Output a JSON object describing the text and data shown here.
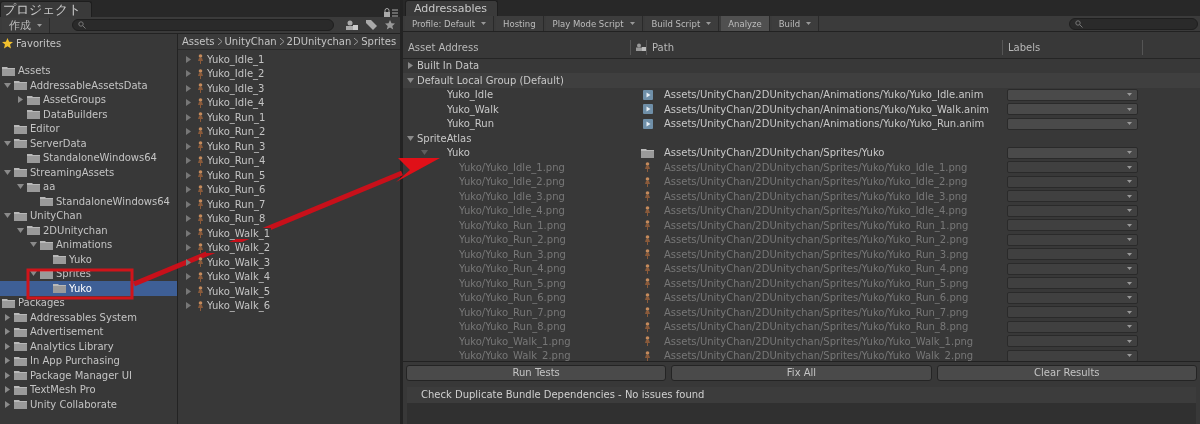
{
  "project": {
    "tab": {
      "label": "プロジェクト",
      "selected": true
    },
    "toolbar": {
      "create": "作成"
    },
    "favorites": {
      "label": "Favorites"
    },
    "tree": [
      {
        "label": "Assets",
        "children": [
          {
            "label": "AddressableAssetsData",
            "expanded": true,
            "children": [
              {
                "label": "AssetGroups",
                "expanded": false
              },
              {
                "label": "DataBuilders"
              }
            ]
          },
          {
            "label": "Editor"
          },
          {
            "label": "ServerData",
            "expanded": true,
            "children": [
              {
                "label": "StandaloneWindows64"
              }
            ]
          },
          {
            "label": "StreamingAssets",
            "expanded": true,
            "children": [
              {
                "label": "aa",
                "expanded": true,
                "children": [
                  {
                    "label": "StandaloneWindows64"
                  }
                ]
              }
            ]
          },
          {
            "label": "UnityChan",
            "expanded": true,
            "children": [
              {
                "label": "2DUnitychan",
                "expanded": true,
                "children": [
                  {
                    "label": "Animations",
                    "expanded": true,
                    "children": [
                      {
                        "label": "Yuko",
                        "selected": false
                      }
                    ]
                  },
                  {
                    "label": "Sprites",
                    "expanded": true,
                    "children": [
                      {
                        "label": "Yuko",
                        "selected": true
                      }
                    ]
                  }
                ]
              }
            ]
          }
        ]
      },
      {
        "label": "Packages",
        "children": [
          {
            "label": "Addressables System",
            "expanded": false
          },
          {
            "label": "Advertisement",
            "expanded": false
          },
          {
            "label": "Analytics Library",
            "expanded": false
          },
          {
            "label": "In App Purchasing",
            "expanded": false
          },
          {
            "label": "Package Manager UI",
            "expanded": false
          },
          {
            "label": "TextMesh Pro",
            "expanded": false
          },
          {
            "label": "Unity Collaborate",
            "expanded": false
          }
        ]
      }
    ],
    "breadcrumb": [
      "Assets",
      "UnityChan",
      "2DUnitychan",
      "Sprites"
    ],
    "files": [
      "Yuko_Idle_1",
      "Yuko_Idle_2",
      "Yuko_Idle_3",
      "Yuko_Idle_4",
      "Yuko_Run_1",
      "Yuko_Run_2",
      "Yuko_Run_3",
      "Yuko_Run_4",
      "Yuko_Run_5",
      "Yuko_Run_6",
      "Yuko_Run_7",
      "Yuko_Run_8",
      "Yuko_Walk_1",
      "Yuko_Walk_2",
      "Yuko_Walk_3",
      "Yuko_Walk_4",
      "Yuko_Walk_5",
      "Yuko_Walk_6"
    ]
  },
  "addressables": {
    "tab": {
      "label": "Addressables",
      "selected": true
    },
    "toolbar": [
      {
        "label": "Profile: Default",
        "kind": "dropdown",
        "selected": false
      },
      {
        "label": "Hosting",
        "kind": "button",
        "selected": false
      },
      {
        "label": "Play Mode Script",
        "kind": "dropdown",
        "selected": false
      },
      {
        "label": "Build Script",
        "kind": "dropdown",
        "selected": false
      },
      {
        "label": "Analyze",
        "kind": "button",
        "selected": true
      },
      {
        "label": "Build",
        "kind": "dropdown",
        "selected": false
      }
    ],
    "columns": [
      "Asset Address",
      "Path",
      "Labels"
    ],
    "groups": [
      {
        "label": "Built In Data",
        "expanded": false
      },
      {
        "label": "Default Local Group (Default)",
        "expanded": true,
        "entries": [
          {
            "address": "Yuko_Idle",
            "kind": "anim",
            "path": "Assets/UnityChan/2DUnitychan/Animations/Yuko/Yuko_Idle.anim",
            "disabled": false
          },
          {
            "address": "Yuko_Walk",
            "kind": "anim",
            "path": "Assets/UnityChan/2DUnitychan/Animations/Yuko/Yuko_Walk.anim",
            "disabled": false
          },
          {
            "address": "Yuko_Run",
            "kind": "anim",
            "path": "Assets/UnityChan/2DUnitychan/Animations/Yuko/Yuko_Run.anim",
            "disabled": false
          }
        ]
      },
      {
        "label": "SpriteAtlas",
        "expanded": true,
        "entries": [
          {
            "address": "Yuko",
            "kind": "folder",
            "path": "Assets/UnityChan/2DUnitychan/Sprites/Yuko",
            "disabled": false,
            "expanded": true,
            "children": [
              {
                "address": "Yuko/Yuko_Idle_1.png",
                "kind": "sprite",
                "path": "Assets/UnityChan/2DUnitychan/Sprites/Yuko/Yuko_Idle_1.png",
                "disabled": true
              },
              {
                "address": "Yuko/Yuko_Idle_2.png",
                "kind": "sprite",
                "path": "Assets/UnityChan/2DUnitychan/Sprites/Yuko/Yuko_Idle_2.png",
                "disabled": true
              },
              {
                "address": "Yuko/Yuko_Idle_3.png",
                "kind": "sprite",
                "path": "Assets/UnityChan/2DUnitychan/Sprites/Yuko/Yuko_Idle_3.png",
                "disabled": true
              },
              {
                "address": "Yuko/Yuko_Idle_4.png",
                "kind": "sprite",
                "path": "Assets/UnityChan/2DUnitychan/Sprites/Yuko/Yuko_Idle_4.png",
                "disabled": true
              },
              {
                "address": "Yuko/Yuko_Run_1.png",
                "kind": "sprite",
                "path": "Assets/UnityChan/2DUnitychan/Sprites/Yuko/Yuko_Run_1.png",
                "disabled": true
              },
              {
                "address": "Yuko/Yuko_Run_2.png",
                "kind": "sprite",
                "path": "Assets/UnityChan/2DUnitychan/Sprites/Yuko/Yuko_Run_2.png",
                "disabled": true
              },
              {
                "address": "Yuko/Yuko_Run_3.png",
                "kind": "sprite",
                "path": "Assets/UnityChan/2DUnitychan/Sprites/Yuko/Yuko_Run_3.png",
                "disabled": true
              },
              {
                "address": "Yuko/Yuko_Run_4.png",
                "kind": "sprite",
                "path": "Assets/UnityChan/2DUnitychan/Sprites/Yuko/Yuko_Run_4.png",
                "disabled": true
              },
              {
                "address": "Yuko/Yuko_Run_5.png",
                "kind": "sprite",
                "path": "Assets/UnityChan/2DUnitychan/Sprites/Yuko/Yuko_Run_5.png",
                "disabled": true
              },
              {
                "address": "Yuko/Yuko_Run_6.png",
                "kind": "sprite",
                "path": "Assets/UnityChan/2DUnitychan/Sprites/Yuko/Yuko_Run_6.png",
                "disabled": true
              },
              {
                "address": "Yuko/Yuko_Run_7.png",
                "kind": "sprite",
                "path": "Assets/UnityChan/2DUnitychan/Sprites/Yuko/Yuko_Run_7.png",
                "disabled": true
              },
              {
                "address": "Yuko/Yuko_Run_8.png",
                "kind": "sprite",
                "path": "Assets/UnityChan/2DUnitychan/Sprites/Yuko/Yuko_Run_8.png",
                "disabled": true
              },
              {
                "address": "Yuko/Yuko_Walk_1.png",
                "kind": "sprite",
                "path": "Assets/UnityChan/2DUnitychan/Sprites/Yuko/Yuko_Walk_1.png",
                "disabled": true
              },
              {
                "address": "Yuko/Yuko_Walk_2.png",
                "kind": "sprite",
                "path": "Assets/UnityChan/2DUnitychan/Sprites/Yuko/Yuko_Walk_2.png",
                "disabled": true
              }
            ]
          }
        ]
      }
    ],
    "actions": [
      "Run Tests",
      "Fix All",
      "Clear Results"
    ],
    "results": [
      {
        "label": "Check Duplicate Bundle Dependencies - No issues found"
      }
    ]
  }
}
